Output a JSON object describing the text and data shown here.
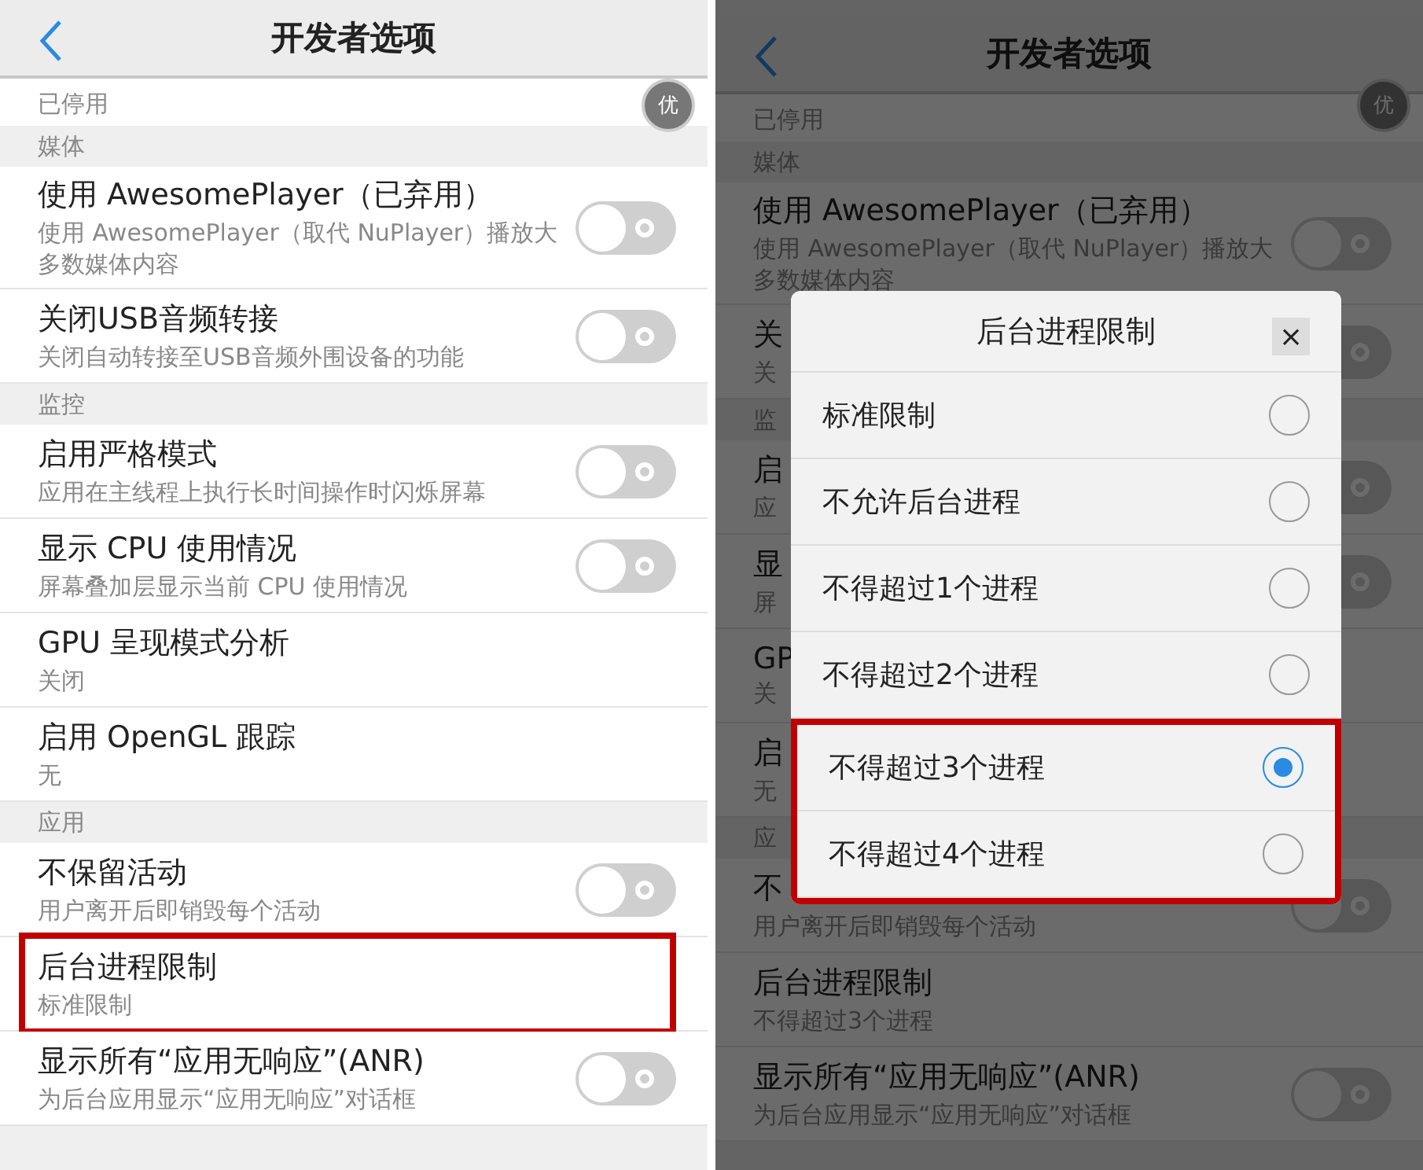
{
  "screens": [
    {
      "dimmed": false,
      "header": {
        "title": "开发者选项"
      },
      "badge": "优",
      "items": [
        {
          "kind": "partial",
          "title": "已停用"
        },
        {
          "kind": "section",
          "title": "媒体"
        },
        {
          "kind": "setting",
          "title": "使用 AwesomePlayer（已弃用）",
          "subtitle": "使用 AwesomePlayer（取代 NuPlayer）播放大多数媒体内容",
          "toggle": {
            "on": false
          },
          "highlighted": false
        },
        {
          "kind": "setting",
          "title": "关闭USB音频转接",
          "subtitle": "关闭自动转接至USB音频外围设备的功能",
          "toggle": {
            "on": false
          },
          "highlighted": false
        },
        {
          "kind": "section",
          "title": "监控"
        },
        {
          "kind": "setting",
          "title": "启用严格模式",
          "subtitle": "应用在主线程上执行长时间操作时闪烁屏幕",
          "toggle": {
            "on": false
          },
          "highlighted": false
        },
        {
          "kind": "setting",
          "title": "显示 CPU 使用情况",
          "subtitle": "屏幕叠加层显示当前 CPU 使用情况",
          "toggle": {
            "on": false
          },
          "highlighted": false
        },
        {
          "kind": "setting",
          "title": "GPU 呈现模式分析",
          "subtitle": "关闭",
          "highlighted": false
        },
        {
          "kind": "setting",
          "title": "启用 OpenGL 跟踪",
          "subtitle": "无",
          "highlighted": false
        },
        {
          "kind": "section",
          "title": "应用"
        },
        {
          "kind": "setting",
          "title": "不保留活动",
          "subtitle": "用户离开后即销毁每个活动",
          "toggle": {
            "on": false
          },
          "highlighted": false
        },
        {
          "kind": "setting",
          "title": "后台进程限制",
          "subtitle": "标准限制",
          "highlighted": true
        },
        {
          "kind": "setting",
          "title": "显示所有“应用无响应”(ANR)",
          "subtitle": "为后台应用显示“应用无响应”对话框",
          "toggle": {
            "on": false
          },
          "highlighted": false
        }
      ]
    },
    {
      "dimmed": true,
      "header": {
        "title": "开发者选项"
      },
      "badge": "优",
      "items": [
        {
          "kind": "partial",
          "title": "已停用"
        },
        {
          "kind": "section",
          "title": "媒体"
        },
        {
          "kind": "setting",
          "title": "使用 AwesomePlayer（已弃用）",
          "subtitle": "使用 AwesomePlayer（取代 NuPlayer）播放大多数媒体内容",
          "toggle": {
            "on": false
          },
          "highlighted": false
        },
        {
          "kind": "setting",
          "title": "关",
          "subtitle": "关",
          "toggle": {
            "on": false
          },
          "highlighted": false
        },
        {
          "kind": "section",
          "title": "监"
        },
        {
          "kind": "setting",
          "title": "启",
          "subtitle": "应",
          "toggle": {
            "on": false
          },
          "highlighted": false
        },
        {
          "kind": "setting",
          "title": "显",
          "subtitle": "屏",
          "toggle": {
            "on": false
          },
          "highlighted": false
        },
        {
          "kind": "setting",
          "title": "GP",
          "subtitle": "关",
          "highlighted": false
        },
        {
          "kind": "setting",
          "title": "启",
          "subtitle": "无",
          "highlighted": false
        },
        {
          "kind": "section",
          "title": "应"
        },
        {
          "kind": "setting",
          "title": "不",
          "subtitle": "用户离开后即销毁每个活动",
          "toggle": {
            "on": false
          },
          "highlighted": false
        },
        {
          "kind": "setting",
          "title": "后台进程限制",
          "subtitle": "不得超过3个进程",
          "highlighted": false
        },
        {
          "kind": "setting",
          "title": "显示所有“应用无响应”(ANR)",
          "subtitle": "为后台应用显示“应用无响应”对话框",
          "toggle": {
            "on": false
          },
          "highlighted": false
        }
      ],
      "dialog": {
        "title": "后台进程限制",
        "close": "×",
        "options": [
          {
            "label": "标准限制",
            "selected": false,
            "highlighted": false
          },
          {
            "label": "不允许后台进程",
            "selected": false,
            "highlighted": false
          },
          {
            "label": "不得超过1个进程",
            "selected": false,
            "highlighted": false
          },
          {
            "label": "不得超过2个进程",
            "selected": false,
            "highlighted": false
          },
          {
            "label": "不得超过3个进程",
            "selected": true,
            "highlighted": true
          },
          {
            "label": "不得超过4个进程",
            "selected": false,
            "highlighted": true
          }
        ]
      }
    }
  ]
}
